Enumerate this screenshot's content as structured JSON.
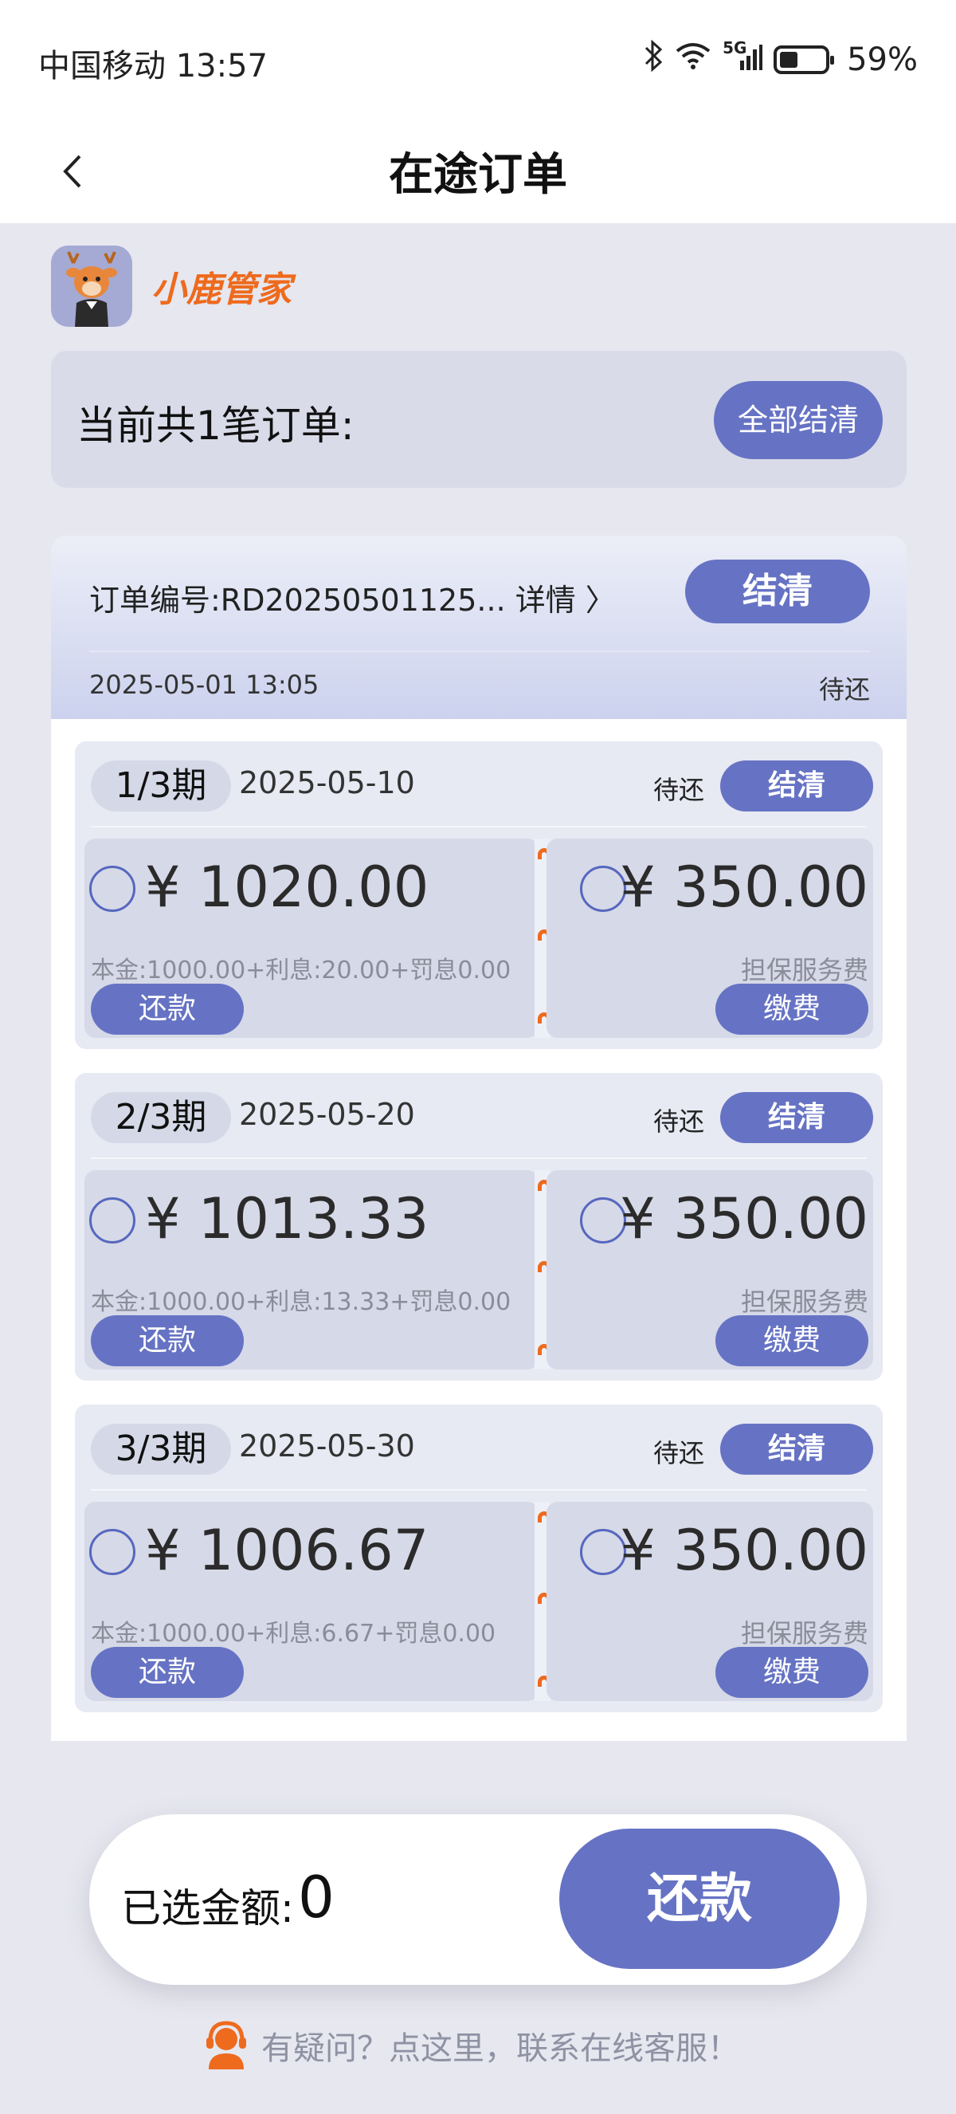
{
  "status_bar": {
    "carrier_time": "中国移动 13:57",
    "network": "5G",
    "battery": "59%"
  },
  "header": {
    "title": "在途订单"
  },
  "brand": {
    "name": "小鹿管家"
  },
  "summary": {
    "text": "当前共1笔订单:",
    "settle_all": "全部结清"
  },
  "order": {
    "number": "订单编号:RD20250501125... 详情 〉",
    "settle": "结清",
    "created": "2025-05-01 13:05",
    "status": "待还"
  },
  "periods": [
    {
      "tag": "1/3期",
      "date": "2025-05-10",
      "status": "待还",
      "settle": "结清",
      "amount": "¥ 1020.00",
      "breakdown": "本金:1000.00+利息:20.00+罚息0.00",
      "repay": "还款",
      "fee_amount": "¥ 350.00",
      "fee_label": "担保服务费",
      "fee_button": "缴费"
    },
    {
      "tag": "2/3期",
      "date": "2025-05-20",
      "status": "待还",
      "settle": "结清",
      "amount": "¥ 1013.33",
      "breakdown": "本金:1000.00+利息:13.33+罚息0.00",
      "repay": "还款",
      "fee_amount": "¥ 350.00",
      "fee_label": "担保服务费",
      "fee_button": "缴费"
    },
    {
      "tag": "3/3期",
      "date": "2025-05-30",
      "status": "待还",
      "settle": "结清",
      "amount": "¥ 1006.67",
      "breakdown": "本金:1000.00+利息:6.67+罚息0.00",
      "repay": "还款",
      "fee_amount": "¥ 350.00",
      "fee_label": "担保服务费",
      "fee_button": "缴费"
    }
  ],
  "bottom": {
    "selected_label": "已选金额:",
    "selected_value": "0",
    "repay": "还款"
  },
  "help": {
    "text": "有疑问？点这里，联系在线客服！"
  },
  "colors": {
    "accent": "#6673c4",
    "brand": "#ee6a1d",
    "background": "#e6e7ef"
  }
}
